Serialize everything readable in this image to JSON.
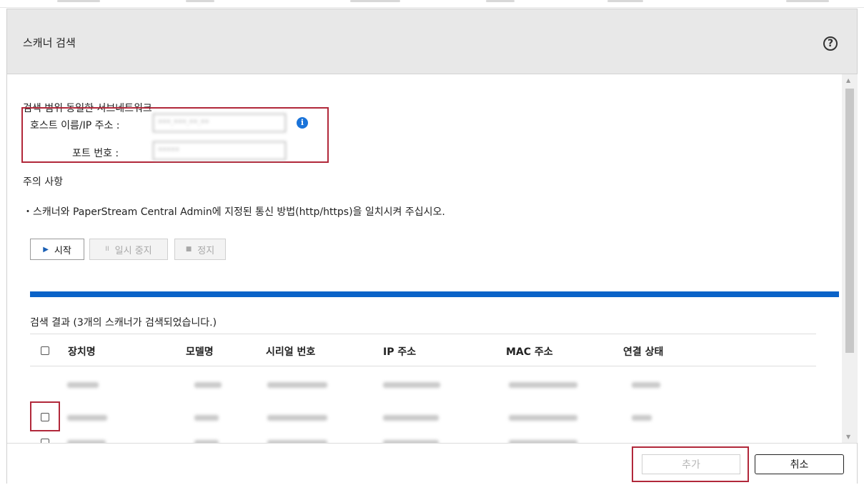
{
  "dialog": {
    "title": "스캐너 검색"
  },
  "search": {
    "range_label": "검색 범위 동일한 서브네트워크",
    "host_label": "호스트 이름/IP 주소 :",
    "host_value": "***.***.**.**",
    "port_label": "포트 번호 :",
    "port_value": "*****"
  },
  "notes": {
    "heading": "주의 사항",
    "item1": "・스캐너와 PaperStream Central Admin에 지정된 통신 방법(http/https)을 일치시켜 주십시오."
  },
  "controls": {
    "start": "시작",
    "pause": "일시 중지",
    "stop": "정지"
  },
  "progress": {
    "percent": 100,
    "color": "#0a63c8"
  },
  "results": {
    "summary": "검색 결과 (3개의 스캐너가 검색되었습니다.)",
    "columns": [
      "장치명",
      "모델명",
      "시리얼 번호",
      "IP 주소",
      "MAC 주소",
      "연결 상태"
    ],
    "row_count": 3
  },
  "footer": {
    "add": "추가",
    "cancel": "취소"
  },
  "icons": {
    "help": "question-circle-icon",
    "info": "info-circle-icon"
  }
}
